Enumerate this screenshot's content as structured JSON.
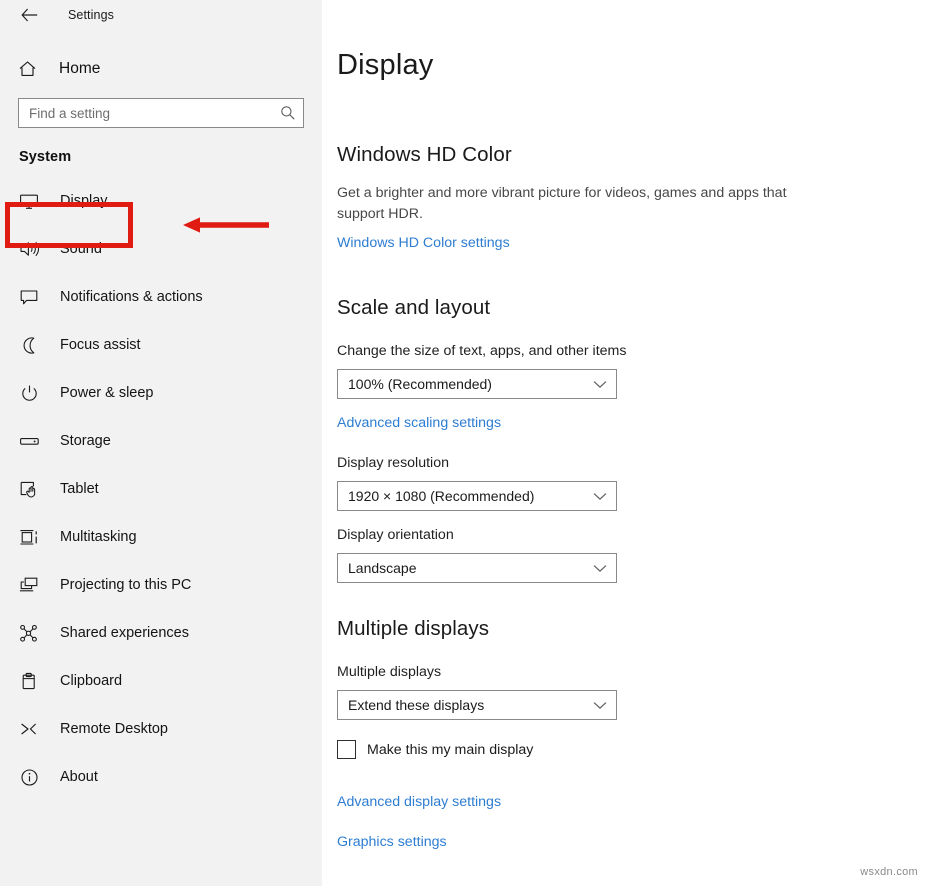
{
  "window": {
    "title": "Settings",
    "back_icon": "back-arrow-icon"
  },
  "sidebar": {
    "home": {
      "label": "Home",
      "icon": "home-icon"
    },
    "search": {
      "placeholder": "Find a setting",
      "value": "",
      "icon": "search-icon"
    },
    "group_title": "System",
    "items": [
      {
        "label": "Display",
        "icon": "monitor-icon",
        "selected": true
      },
      {
        "label": "Sound",
        "icon": "speaker-icon",
        "selected": false
      },
      {
        "label": "Notifications & actions",
        "icon": "notification-bubble-icon",
        "selected": false
      },
      {
        "label": "Focus assist",
        "icon": "moon-icon",
        "selected": false
      },
      {
        "label": "Power & sleep",
        "icon": "power-icon",
        "selected": false
      },
      {
        "label": "Storage",
        "icon": "drive-icon",
        "selected": false
      },
      {
        "label": "Tablet",
        "icon": "tablet-hand-icon",
        "selected": false
      },
      {
        "label": "Multitasking",
        "icon": "multitasking-icon",
        "selected": false
      },
      {
        "label": "Projecting to this PC",
        "icon": "projecting-icon",
        "selected": false
      },
      {
        "label": "Shared experiences",
        "icon": "share-nodes-icon",
        "selected": false
      },
      {
        "label": "Clipboard",
        "icon": "clipboard-icon",
        "selected": false
      },
      {
        "label": "Remote Desktop",
        "icon": "remote-desktop-icon",
        "selected": false
      },
      {
        "label": "About",
        "icon": "info-circle-icon",
        "selected": false
      }
    ]
  },
  "main": {
    "page_title": "Display",
    "hd_color": {
      "heading": "Windows HD Color",
      "description": "Get a brighter and more vibrant picture for videos, games and apps that support HDR.",
      "link": "Windows HD Color settings"
    },
    "scale_layout": {
      "heading": "Scale and layout",
      "scale_label": "Change the size of text, apps, and other items",
      "scale_value": "100% (Recommended)",
      "advanced_scaling_link": "Advanced scaling settings",
      "resolution_label": "Display resolution",
      "resolution_value": "1920 × 1080 (Recommended)",
      "orientation_label": "Display orientation",
      "orientation_value": "Landscape"
    },
    "multiple_displays": {
      "heading": "Multiple displays",
      "field_label": "Multiple displays",
      "field_value": "Extend these displays",
      "checkbox_label": "Make this my main display",
      "checkbox_checked": false,
      "advanced_display_link": "Advanced display settings",
      "graphics_link": "Graphics settings"
    }
  },
  "annotations": {
    "highlight_color": "#e01b11",
    "highlight_target": "Display",
    "arrow_direction": "left"
  },
  "watermark": {
    "text": "wsxdn.com"
  },
  "colors": {
    "sidebar_bg": "#f2f2f2",
    "main_bg": "#ffffff",
    "link": "#2d7dd2",
    "text": "#1a1a1a",
    "muted_text": "#484848",
    "border": "#898989",
    "annotation_red": "#e01b11"
  }
}
